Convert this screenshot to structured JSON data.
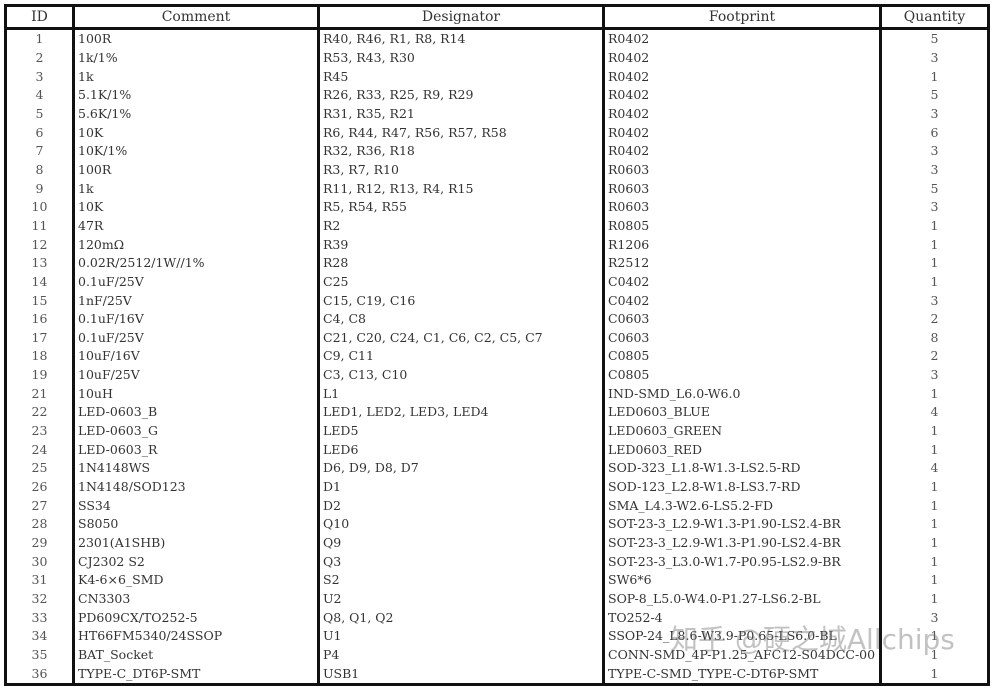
{
  "headers": [
    "ID",
    "Comment",
    "Designator",
    "Footprint",
    "Quantity"
  ],
  "rows": [
    {
      "id": "1",
      "comment": "100R",
      "designator": "R40, R46, R1, R8, R14",
      "footprint": "R0402",
      "quantity": "5"
    },
    {
      "id": "2",
      "comment": "1k/1%",
      "designator": "R53, R43, R30",
      "footprint": "R0402",
      "quantity": "3"
    },
    {
      "id": "3",
      "comment": "1k",
      "designator": "R45",
      "footprint": "R0402",
      "quantity": "1"
    },
    {
      "id": "4",
      "comment": "5.1K/1%",
      "designator": "R26, R33, R25, R9, R29",
      "footprint": "R0402",
      "quantity": "5"
    },
    {
      "id": "5",
      "comment": "5.6K/1%",
      "designator": "R31, R35, R21",
      "footprint": "R0402",
      "quantity": "3"
    },
    {
      "id": "6",
      "comment": "10K",
      "designator": "R6, R44, R47, R56, R57, R58",
      "footprint": "R0402",
      "quantity": "6"
    },
    {
      "id": "7",
      "comment": "10K/1%",
      "designator": "R32, R36, R18",
      "footprint": "R0402",
      "quantity": "3"
    },
    {
      "id": "8",
      "comment": "100R",
      "designator": "R3, R7, R10",
      "footprint": "R0603",
      "quantity": "3"
    },
    {
      "id": "9",
      "comment": "1k",
      "designator": "R11, R12, R13, R4, R15",
      "footprint": "R0603",
      "quantity": "5"
    },
    {
      "id": "10",
      "comment": "10K",
      "designator": "R5, R54, R55",
      "footprint": "R0603",
      "quantity": "3"
    },
    {
      "id": "11",
      "comment": "47R",
      "designator": "R2",
      "footprint": "R0805",
      "quantity": "1"
    },
    {
      "id": "12",
      "comment": "120mΩ",
      "designator": "R39",
      "footprint": "R1206",
      "quantity": "1"
    },
    {
      "id": "13",
      "comment": "0.02R/2512/1W//1%",
      "designator": "R28",
      "footprint": "R2512",
      "quantity": "1"
    },
    {
      "id": "14",
      "comment": "0.1uF/25V",
      "designator": "C25",
      "footprint": "C0402",
      "quantity": "1"
    },
    {
      "id": "15",
      "comment": "1nF/25V",
      "designator": "C15, C19, C16",
      "footprint": "C0402",
      "quantity": "3"
    },
    {
      "id": "16",
      "comment": "0.1uF/16V",
      "designator": "C4, C8",
      "footprint": "C0603",
      "quantity": "2"
    },
    {
      "id": "17",
      "comment": "0.1uF/25V",
      "designator": "C21, C20, C24, C1, C6, C2, C5, C7",
      "footprint": "C0603",
      "quantity": "8"
    },
    {
      "id": "18",
      "comment": "10uF/16V",
      "designator": "C9, C11",
      "footprint": "C0805",
      "quantity": "2"
    },
    {
      "id": "19",
      "comment": "10uF/25V",
      "designator": "C3, C13, C10",
      "footprint": "C0805",
      "quantity": "3"
    },
    {
      "id": "21",
      "comment": "10uH",
      "designator": "L1",
      "footprint": "IND-SMD_L6.0-W6.0",
      "quantity": "1"
    },
    {
      "id": "22",
      "comment": "LED-0603_B",
      "designator": "LED1, LED2, LED3, LED4",
      "footprint": "LED0603_BLUE",
      "quantity": "4"
    },
    {
      "id": "23",
      "comment": "LED-0603_G",
      "designator": "LED5",
      "footprint": "LED0603_GREEN",
      "quantity": "1"
    },
    {
      "id": "24",
      "comment": "LED-0603_R",
      "designator": "LED6",
      "footprint": "LED0603_RED",
      "quantity": "1"
    },
    {
      "id": "25",
      "comment": "1N4148WS",
      "designator": "D6, D9, D8, D7",
      "footprint": "SOD-323_L1.8-W1.3-LS2.5-RD",
      "quantity": "4"
    },
    {
      "id": "26",
      "comment": "1N4148/SOD123",
      "designator": "D1",
      "footprint": "SOD-123_L2.8-W1.8-LS3.7-RD",
      "quantity": "1"
    },
    {
      "id": "27",
      "comment": "SS34",
      "designator": "D2",
      "footprint": "SMA_L4.3-W2.6-LS5.2-FD",
      "quantity": "1"
    },
    {
      "id": "28",
      "comment": "S8050",
      "designator": "Q10",
      "footprint": "SOT-23-3_L2.9-W1.3-P1.90-LS2.4-BR",
      "quantity": "1"
    },
    {
      "id": "29",
      "comment": "2301(A1SHB)",
      "designator": "Q9",
      "footprint": "SOT-23-3_L2.9-W1.3-P1.90-LS2.4-BR",
      "quantity": "1"
    },
    {
      "id": "30",
      "comment": "CJ2302 S2",
      "designator": "Q3",
      "footprint": "SOT-23-3_L3.0-W1.7-P0.95-LS2.9-BR",
      "quantity": "1"
    },
    {
      "id": "31",
      "comment": "K4-6×6_SMD",
      "designator": "S2",
      "footprint": "SW6*6",
      "quantity": "1"
    },
    {
      "id": "32",
      "comment": "CN3303",
      "designator": "U2",
      "footprint": "SOP-8_L5.0-W4.0-P1.27-LS6.2-BL",
      "quantity": "1"
    },
    {
      "id": "33",
      "comment": "PD609CX/TO252-5",
      "designator": "Q8, Q1, Q2",
      "footprint": "TO252-4",
      "quantity": "3"
    },
    {
      "id": "34",
      "comment": "HT66FM5340/24SSOP",
      "designator": "U1",
      "footprint": "SSOP-24_L8.6-W3.9-P0.65-LS6.0-BL",
      "quantity": "1"
    },
    {
      "id": "35",
      "comment": "BAT_Socket",
      "designator": "P4",
      "footprint": "CONN-SMD_4P-P1.25_AFC12-S04DCC-00",
      "quantity": "1"
    },
    {
      "id": "36",
      "comment": "TYPE-C_DT6P-SMT",
      "designator": "USB1",
      "footprint": "TYPE-C-SMD_TYPE-C-DT6P-SMT",
      "quantity": "1"
    }
  ],
  "watermark": "知乎 @硬之城Allchips"
}
